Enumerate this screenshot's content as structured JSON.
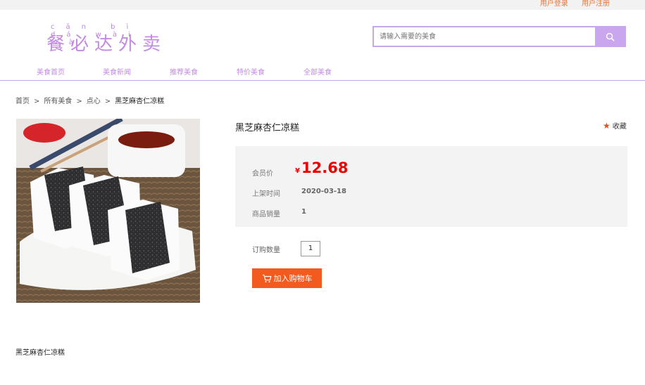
{
  "header": {
    "login_link": "用户登录",
    "register_link": "用户注册",
    "logo_pinyin": "cān bì dá wài mài",
    "logo_text": "餐必达外卖"
  },
  "search": {
    "placeholder": "请输入需要的美食",
    "icon": "search-icon"
  },
  "nav": {
    "items": [
      "美食首页",
      "美食新闻",
      "推荐美食",
      "特价美食",
      "全部美食"
    ]
  },
  "breadcrumb": {
    "items": [
      "首页",
      "所有美食",
      "点心",
      "黑芝麻杏仁凉糕"
    ],
    "separator": ">"
  },
  "product": {
    "title": "黑芝麻杏仁凉糕",
    "favorite_label": "收藏",
    "price_label": "会员价",
    "currency": "¥",
    "price": "12.68",
    "listed_label": "上架时间",
    "listed_date": "2020-03-18",
    "sales_label": "商品销量",
    "sales": "1",
    "qty_label": "订购数量",
    "qty": "1",
    "add_to_cart": "加入购物车",
    "description": "黑芝麻杏仁凉糕"
  },
  "colors": {
    "accent": "#c8a8ec",
    "nav_text": "#c08be0",
    "price": "#e00000",
    "cart_button": "#f25a1e",
    "star": "#e8501c"
  }
}
